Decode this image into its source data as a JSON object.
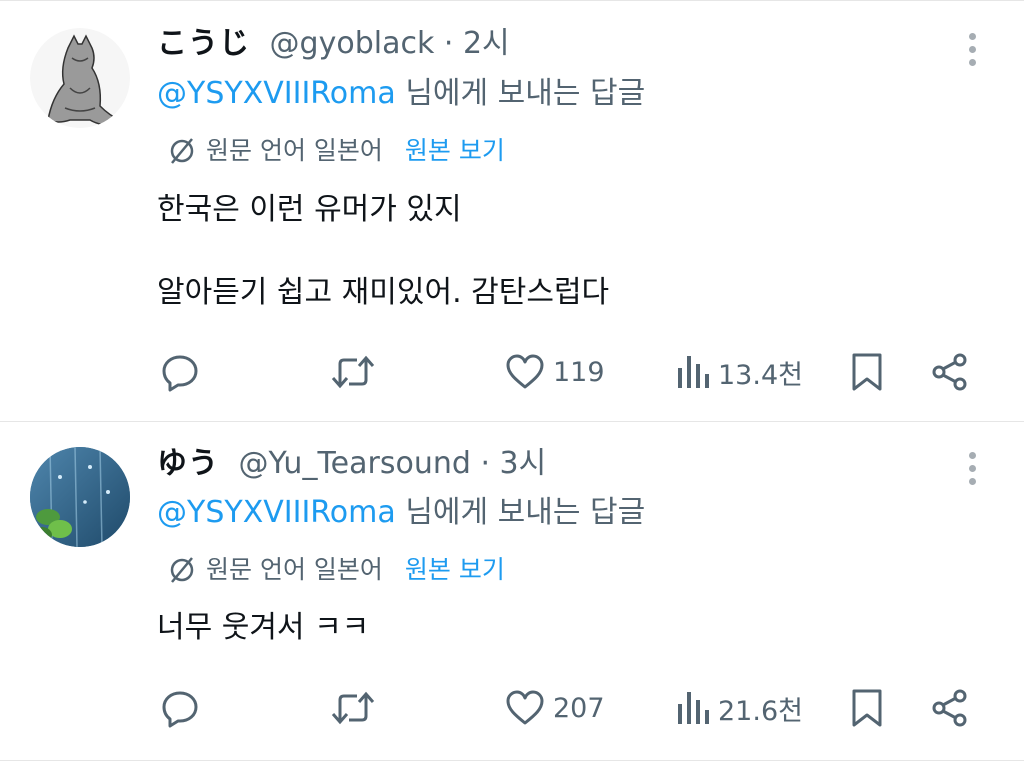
{
  "tweets": [
    {
      "name": "こうじ",
      "handle": "@gyoblack",
      "dot": "·",
      "time": "2시",
      "reply_mention": "@YSYXVIIIRoma",
      "reply_suffix": " 님에게 보내는 답글",
      "translate_label": "원문 언어 일본어",
      "translate_link": "원본 보기",
      "lines": [
        "한국은 이런 유머가 있지",
        "알아듣기 쉽고 재미있어. 감탄스럽다"
      ],
      "likes": "119",
      "views": "13.4천"
    },
    {
      "name": "ゆう",
      "handle": "@Yu_Tearsound",
      "dot": "·",
      "time": "3시",
      "reply_mention": "@YSYXVIIIRoma",
      "reply_suffix": " 님에게 보내는 답글",
      "translate_label": "원문 언어 일본어",
      "translate_link": "원본 보기",
      "lines": [
        "너무 웃겨서 ㅋㅋ"
      ],
      "likes": "207",
      "views": "21.6천"
    }
  ],
  "icons": [
    "reply-icon",
    "retweet-icon",
    "like-icon",
    "views-icon",
    "bookmark-icon",
    "share-icon",
    "more-icon",
    "translate-icon"
  ],
  "colors": {
    "accent": "#1d9bf0",
    "secondary": "#536471",
    "text": "#0f1419"
  }
}
